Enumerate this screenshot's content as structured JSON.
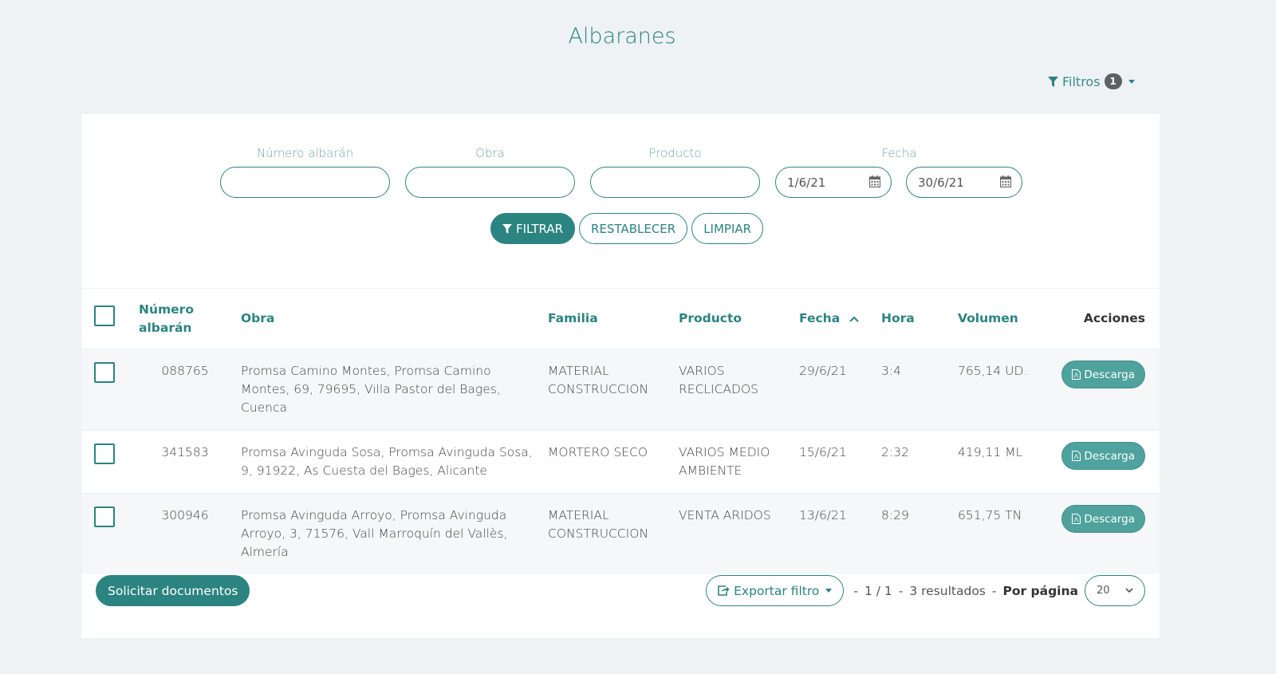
{
  "page": {
    "title": "Albaranes"
  },
  "filters_toggle": {
    "label": "Filtros",
    "count": "1"
  },
  "filter_form": {
    "numero_label": "Número albarán",
    "numero_value": "",
    "obra_label": "Obra",
    "obra_value": "",
    "producto_label": "Producto",
    "producto_value": "",
    "fecha_label": "Fecha",
    "fecha_from": "1/6/21",
    "fecha_to": "30/6/21",
    "filtrar_label": "FILTRAR",
    "restablecer_label": "RESTABLECER",
    "limpiar_label": "LIMPIAR"
  },
  "table": {
    "headers": {
      "numero_line1": "Número",
      "numero_line2": "albarán",
      "obra": "Obra",
      "familia": "Familia",
      "producto": "Producto",
      "fecha": "Fecha",
      "hora": "Hora",
      "volumen": "Volumen",
      "acciones": "Acciones"
    },
    "sort": {
      "column": "fecha",
      "direction": "asc"
    },
    "rows": [
      {
        "numero": "088765",
        "obra": "Promsa Camino Montes, Promsa Camino Montes, 69, 79695, Villa Pastor del Bages, Cuenca",
        "familia": "MATERIAL CONSTRUCCION",
        "producto": "VARIOS RECLICADOS",
        "fecha": "29/6/21",
        "hora": "3:4",
        "volumen": "765,14 UD.",
        "action": "Descarga"
      },
      {
        "numero": "341583",
        "obra": "Promsa Avinguda Sosa, Promsa Avinguda Sosa, 9, 91922, As Cuesta del Bages, Alicante",
        "familia": "MORTERO SECO",
        "producto": "VARIOS MEDIO AMBIENTE",
        "fecha": "15/6/21",
        "hora": "2:32",
        "volumen": "419,11 ML",
        "action": "Descarga"
      },
      {
        "numero": "300946",
        "obra": "Promsa Avinguda Arroyo, Promsa Avinguda Arroyo, 3, 71576, Vall Marroquín del Vallès, Almería",
        "familia": "MATERIAL CONSTRUCCION",
        "producto": "VENTA ARIDOS",
        "fecha": "13/6/21",
        "hora": "8:29",
        "volumen": "651,75 TN",
        "action": "Descarga"
      }
    ]
  },
  "footer": {
    "request_label": "Solicitar documentos",
    "export_label": "Exportar filtro",
    "page_info": "1 / 1",
    "results": "3 resultados",
    "per_page_label": "Por página",
    "per_page_value": "20",
    "separator": "-"
  },
  "colors": {
    "accent": "#2b8480",
    "background": "#eef2f5",
    "badge": "#5d6166"
  }
}
